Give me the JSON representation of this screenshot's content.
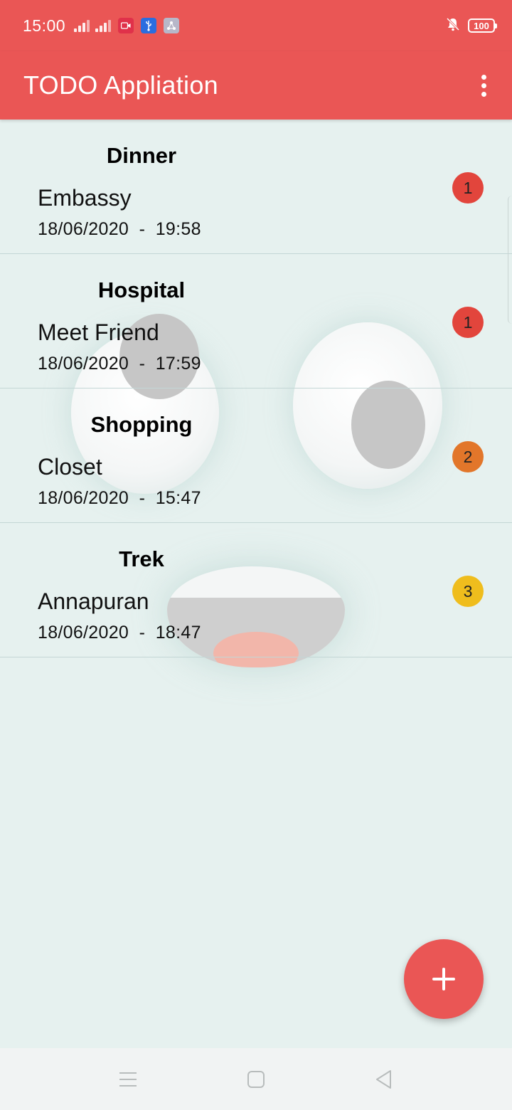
{
  "status_bar": {
    "time": "15:00",
    "battery": "100",
    "icons": [
      "signal-icon",
      "signal-icon",
      "video-record-icon",
      "usb-icon",
      "share-icon",
      "mute-icon",
      "battery-icon"
    ]
  },
  "app_bar": {
    "title": "TODO Appliation",
    "menu_icon": "more-vert-icon"
  },
  "todos": [
    {
      "category": "Dinner",
      "title": "Embassy",
      "datetime": "18/06/2020  -  19:58",
      "priority": "1",
      "priority_color": "#e2453c"
    },
    {
      "category": "Hospital",
      "title": "Meet Friend",
      "datetime": "18/06/2020  -  17:59",
      "priority": "1",
      "priority_color": "#e2453c"
    },
    {
      "category": "Shopping",
      "title": "Closet",
      "datetime": "18/06/2020  -  15:47",
      "priority": "2",
      "priority_color": "#e2762a"
    },
    {
      "category": "Trek",
      "title": "Annapuran",
      "datetime": "18/06/2020  -  18:47",
      "priority": "3",
      "priority_color": "#efbd1d"
    }
  ],
  "fab": {
    "icon": "plus-icon"
  },
  "nav_bar": {
    "icons": [
      "menu-icon",
      "home-icon",
      "back-icon"
    ]
  },
  "colors": {
    "accent": "#ea5655",
    "background": "#e6f1ef"
  }
}
